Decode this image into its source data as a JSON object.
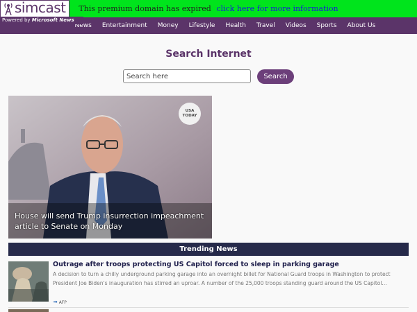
{
  "banner": {
    "text": "This premium domain has expired",
    "link": "click here for more information"
  },
  "logo": {
    "brand": "simcast",
    "powered_prefix": "Powered by ",
    "powered_brand": "Microsoft News"
  },
  "nav": [
    "News",
    "Entertainment",
    "Money",
    "Lifestyle",
    "Health",
    "Travel",
    "Videos",
    "Sports",
    "About Us"
  ],
  "search": {
    "title": "Search Internet",
    "placeholder": "Search here",
    "button": "Search"
  },
  "hero": {
    "badge_line1": "USA",
    "badge_line2": "TODAY",
    "title": "House will send Trump insurrection impeachment article to Senate on Monday"
  },
  "trending": {
    "label": "Trending News"
  },
  "news": [
    {
      "title": "Outrage after troops protecting US Capitol forced to sleep in parking garage",
      "description": "A decision to turn a chilly underground parking garage into an overnight billet for National Guard troops in Washington to protect President Joe Biden's inauguration has stirred an uproar. A number of the 25,000 troops standing guard around the US Capitol...",
      "source": "AFP"
    }
  ],
  "colors": {
    "banner_bg": "#00e41c",
    "brand_purple": "#5b3469",
    "trending_bg": "#262a4a"
  }
}
